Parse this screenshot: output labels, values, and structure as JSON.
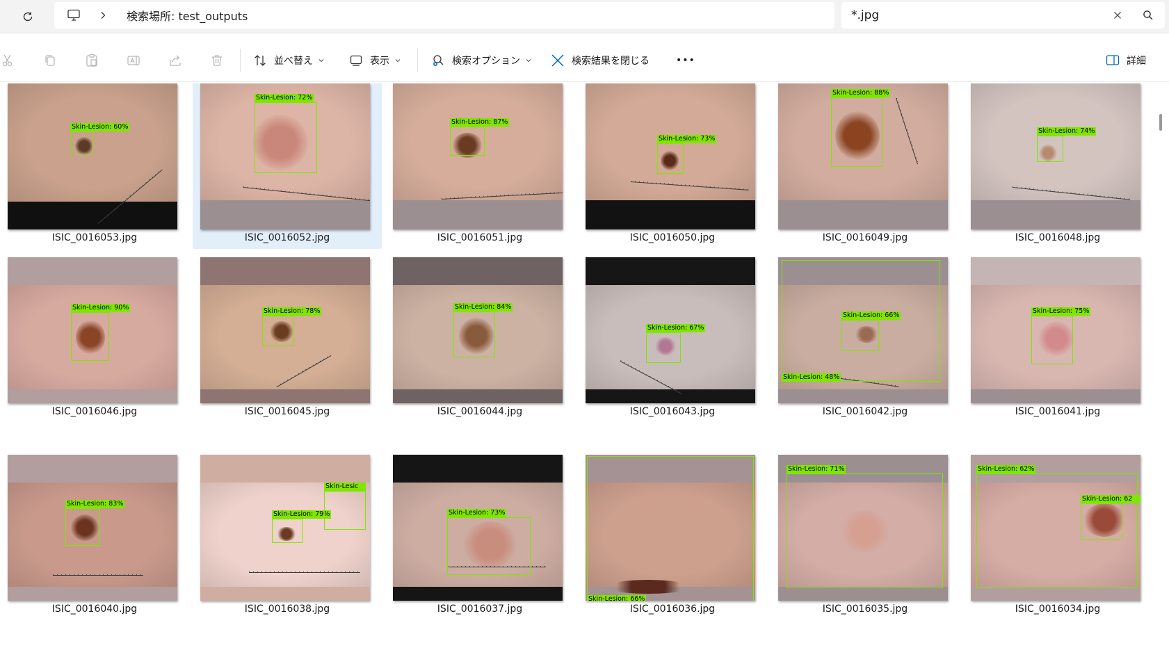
{
  "address": {
    "path_label": "検索場所: test_outputs",
    "search_value": "*.jpg"
  },
  "toolbar": {
    "sort_label": "並べ替え",
    "view_label": "表示",
    "search_options_label": "検索オプション",
    "close_search_label": "検索結果を閉じる",
    "more_label": "•••",
    "details_label": "詳細"
  },
  "files": [
    {
      "name": "ISIC_0016053.jpg",
      "label": "Skin-Lesion: 60%"
    },
    {
      "name": "ISIC_0016052.jpg",
      "label": "Skin-Lesion: 72%"
    },
    {
      "name": "ISIC_0016051.jpg",
      "label": "Skin-Lesion: 87%"
    },
    {
      "name": "ISIC_0016050.jpg",
      "label": "Skin-Lesion: 73%"
    },
    {
      "name": "ISIC_0016049.jpg",
      "label": "Skin-Lesion: 88%"
    },
    {
      "name": "ISIC_0016048.jpg",
      "label": "Skin-Lesion: 74%"
    },
    {
      "name": "ISIC_0016046.jpg",
      "label": "Skin-Lesion: 90%"
    },
    {
      "name": "ISIC_0016045.jpg",
      "label": "Skin-Lesion: 78%"
    },
    {
      "name": "ISIC_0016044.jpg",
      "label": "Skin-Lesion: 84%"
    },
    {
      "name": "ISIC_0016043.jpg",
      "label": "Skin-Lesion: 67%"
    },
    {
      "name": "ISIC_0016042.jpg",
      "label": "Skin-Lesion: 66%",
      "label2": "Skin-Lesion: 48%"
    },
    {
      "name": "ISIC_0016041.jpg",
      "label": "Skin-Lesion: 75%"
    },
    {
      "name": "ISIC_0016040.jpg",
      "label": "Skin-Lesion: 83%"
    },
    {
      "name": "ISIC_0016038.jpg",
      "label": "Skin-Lesion: 79%",
      "label2": "Skin-Lesic"
    },
    {
      "name": "ISIC_0016037.jpg",
      "label": "Skin-Lesion: 73%"
    },
    {
      "name": "ISIC_0016036.jpg",
      "label": "Skin-Lesion: 66%"
    },
    {
      "name": "ISIC_0016035.jpg",
      "label": "Skin-Lesion: 71%"
    },
    {
      "name": "ISIC_0016034.jpg",
      "label": "Skin-Lesion: 62%",
      "label2": "Skin-Lesion: 62"
    }
  ],
  "selected_file": "ISIC_0016052.jpg",
  "colors": {
    "box": "#7fe600",
    "selection": "#e3eefb",
    "accent": "#0067c0"
  }
}
